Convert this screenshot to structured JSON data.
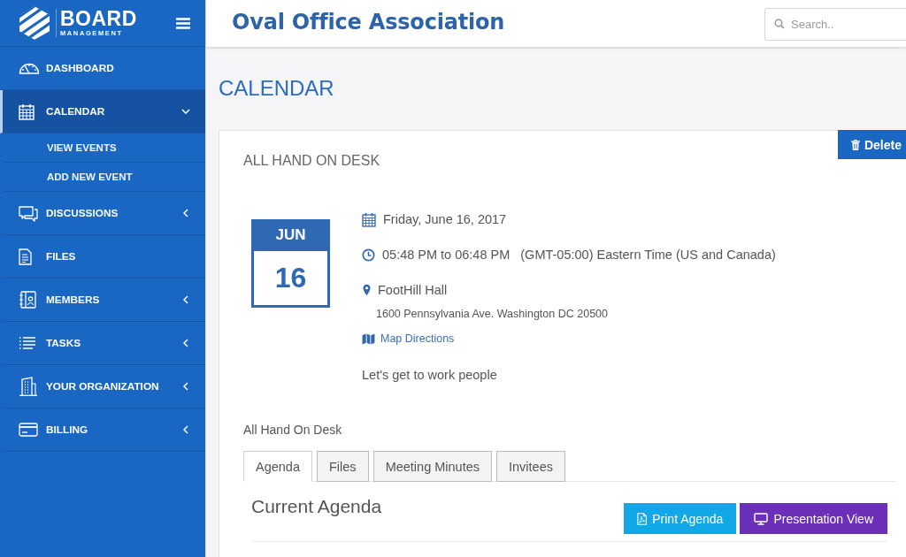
{
  "sidebar": {
    "logo": {
      "title": "BOARD",
      "subtitle": "MANAGEMENT"
    },
    "items": [
      {
        "label": "DASHBOARD",
        "selected": false,
        "expandable": false,
        "expanded": false
      },
      {
        "label": "CALENDAR",
        "selected": true,
        "expandable": true,
        "expanded": true,
        "children": [
          {
            "label": "VIEW EVENTS",
            "selected": false
          },
          {
            "label": "ADD NEW EVENT",
            "selected": false
          }
        ]
      },
      {
        "label": "DISCUSSIONS",
        "selected": false,
        "expandable": true,
        "expanded": false
      },
      {
        "label": "FILES",
        "selected": false,
        "expandable": false,
        "expanded": false
      },
      {
        "label": "MEMBERS",
        "selected": false,
        "expandable": true,
        "expanded": false
      },
      {
        "label": "TASKS",
        "selected": false,
        "expandable": true,
        "expanded": false
      },
      {
        "label": "YOUR ORGANIZATION",
        "selected": false,
        "expandable": true,
        "expanded": false
      },
      {
        "label": "BILLING",
        "selected": false,
        "expandable": true,
        "expanded": false
      }
    ]
  },
  "header": {
    "title": "Oval Office Association",
    "search": {
      "placeholder": "Search.."
    }
  },
  "page": {
    "heading": "CALENDAR",
    "event": {
      "title": "ALL HAND ON DESK",
      "delete_button": "Delete",
      "date_badge": {
        "month": "JUN",
        "day": "16"
      },
      "date": "Friday, June 16, 2017",
      "time": "05:48 PM to 06:48 PM",
      "timezone": "(GMT-05:00) Eastern Time (US and Canada)",
      "venue": "FootHill Hall",
      "address": "1600 Pennsylvania Ave. Washington DC 20500",
      "map_link": "Map Directions",
      "description": "Let's get to work people",
      "subtitle": "All Hand On Desk",
      "tabs": [
        {
          "label": "Agenda",
          "selected": true
        },
        {
          "label": "Files",
          "selected": false
        },
        {
          "label": "Meeting Minutes",
          "selected": false
        },
        {
          "label": "Invitees",
          "selected": false
        }
      ],
      "agenda": {
        "heading": "Current Agenda",
        "buttons": [
          {
            "label": "Print Agenda",
            "kind": "print"
          },
          {
            "label": "Presentation View",
            "kind": "presentation"
          }
        ]
      }
    }
  }
}
